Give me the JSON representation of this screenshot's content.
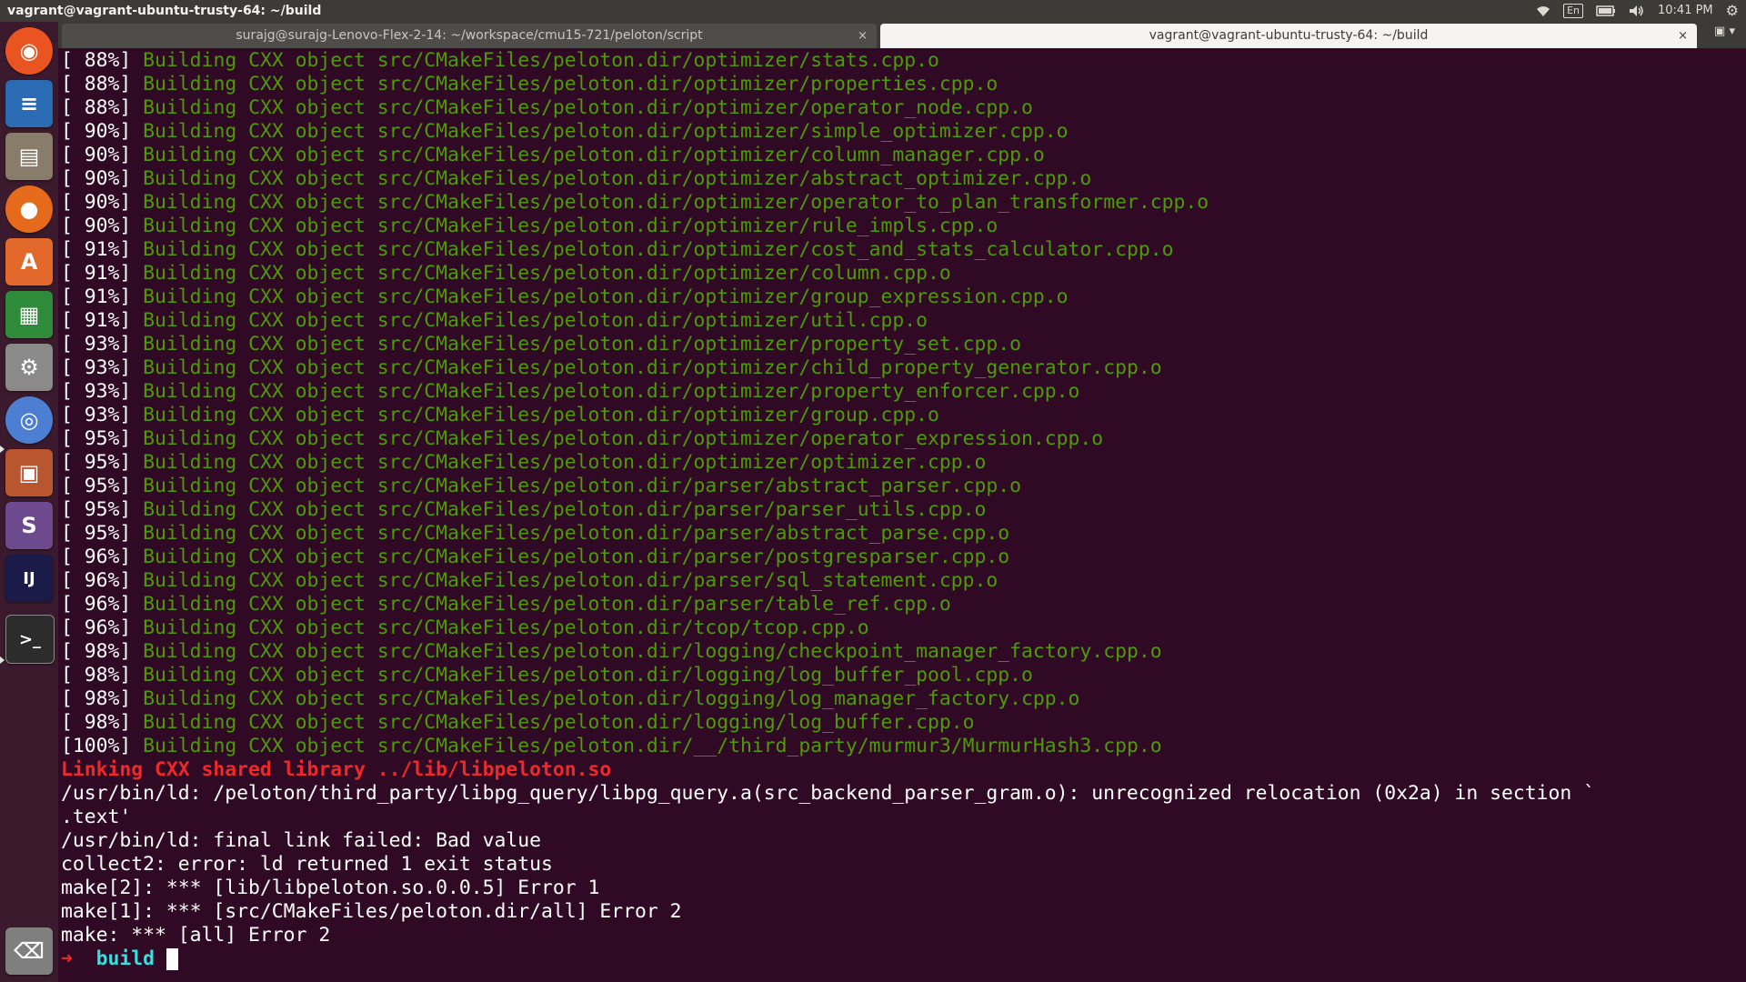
{
  "window": {
    "title": "vagrant@vagrant-ubuntu-trusty-64: ~/build"
  },
  "panel": {
    "keyboard_layout": "En",
    "clock": "10:41 PM",
    "icons": [
      "wifi-icon",
      "keyboard-icon",
      "battery-icon",
      "volume-icon",
      "gear-icon"
    ]
  },
  "launcher": {
    "items": [
      {
        "name": "ubuntu-dash-icon",
        "color": "#e95420",
        "glyph": "◉"
      },
      {
        "name": "writer-icon",
        "color": "#2a6bb3",
        "glyph": "≡"
      },
      {
        "name": "files-icon",
        "color": "#8a7c6a",
        "glyph": "▤"
      },
      {
        "name": "firefox-icon",
        "color": "#e56a1c",
        "glyph": "●"
      },
      {
        "name": "software-center-icon",
        "color": "#e2692b",
        "glyph": "A"
      },
      {
        "name": "calc-icon",
        "color": "#2e8b3a",
        "glyph": "▦"
      },
      {
        "name": "settings-icon",
        "color": "#8a8a8a",
        "glyph": "⚙"
      },
      {
        "name": "chromium-icon",
        "color": "#4c7fd1",
        "glyph": "◎"
      },
      {
        "name": "impress-icon",
        "color": "#b9552f",
        "glyph": "▣"
      },
      {
        "name": "slack-icon",
        "color": "#6d4a8e",
        "glyph": "S"
      },
      {
        "name": "intellij-icon",
        "color": "#1b1b4a",
        "glyph": "IJ"
      },
      {
        "name": "terminal-icon",
        "color": "#2c2c2c",
        "glyph": ">_"
      },
      {
        "name": "trash-icon",
        "color": "#7f7f7f",
        "glyph": "⌫"
      }
    ]
  },
  "tabs": [
    {
      "label": "surajg@surajg-Lenovo-Flex-2-14: ~/workspace/cmu15-721/peloton/script",
      "close": "×"
    },
    {
      "label": "vagrant@vagrant-ubuntu-trusty-64: ~/build",
      "close": "×"
    }
  ],
  "terminal": {
    "build_lines": [
      {
        "pct": "[ 88%]",
        "text": "Building CXX object src/CMakeFiles/peloton.dir/optimizer/stats.cpp.o"
      },
      {
        "pct": "[ 88%]",
        "text": "Building CXX object src/CMakeFiles/peloton.dir/optimizer/properties.cpp.o"
      },
      {
        "pct": "[ 88%]",
        "text": "Building CXX object src/CMakeFiles/peloton.dir/optimizer/operator_node.cpp.o"
      },
      {
        "pct": "[ 90%]",
        "text": "Building CXX object src/CMakeFiles/peloton.dir/optimizer/simple_optimizer.cpp.o"
      },
      {
        "pct": "[ 90%]",
        "text": "Building CXX object src/CMakeFiles/peloton.dir/optimizer/column_manager.cpp.o"
      },
      {
        "pct": "[ 90%]",
        "text": "Building CXX object src/CMakeFiles/peloton.dir/optimizer/abstract_optimizer.cpp.o"
      },
      {
        "pct": "[ 90%]",
        "text": "Building CXX object src/CMakeFiles/peloton.dir/optimizer/operator_to_plan_transformer.cpp.o"
      },
      {
        "pct": "[ 90%]",
        "text": "Building CXX object src/CMakeFiles/peloton.dir/optimizer/rule_impls.cpp.o"
      },
      {
        "pct": "[ 91%]",
        "text": "Building CXX object src/CMakeFiles/peloton.dir/optimizer/cost_and_stats_calculator.cpp.o"
      },
      {
        "pct": "[ 91%]",
        "text": "Building CXX object src/CMakeFiles/peloton.dir/optimizer/column.cpp.o"
      },
      {
        "pct": "[ 91%]",
        "text": "Building CXX object src/CMakeFiles/peloton.dir/optimizer/group_expression.cpp.o"
      },
      {
        "pct": "[ 91%]",
        "text": "Building CXX object src/CMakeFiles/peloton.dir/optimizer/util.cpp.o"
      },
      {
        "pct": "[ 93%]",
        "text": "Building CXX object src/CMakeFiles/peloton.dir/optimizer/property_set.cpp.o"
      },
      {
        "pct": "[ 93%]",
        "text": "Building CXX object src/CMakeFiles/peloton.dir/optimizer/child_property_generator.cpp.o"
      },
      {
        "pct": "[ 93%]",
        "text": "Building CXX object src/CMakeFiles/peloton.dir/optimizer/property_enforcer.cpp.o"
      },
      {
        "pct": "[ 93%]",
        "text": "Building CXX object src/CMakeFiles/peloton.dir/optimizer/group.cpp.o"
      },
      {
        "pct": "[ 95%]",
        "text": "Building CXX object src/CMakeFiles/peloton.dir/optimizer/operator_expression.cpp.o"
      },
      {
        "pct": "[ 95%]",
        "text": "Building CXX object src/CMakeFiles/peloton.dir/optimizer/optimizer.cpp.o"
      },
      {
        "pct": "[ 95%]",
        "text": "Building CXX object src/CMakeFiles/peloton.dir/parser/abstract_parser.cpp.o"
      },
      {
        "pct": "[ 95%]",
        "text": "Building CXX object src/CMakeFiles/peloton.dir/parser/parser_utils.cpp.o"
      },
      {
        "pct": "[ 95%]",
        "text": "Building CXX object src/CMakeFiles/peloton.dir/parser/abstract_parse.cpp.o"
      },
      {
        "pct": "[ 96%]",
        "text": "Building CXX object src/CMakeFiles/peloton.dir/parser/postgresparser.cpp.o"
      },
      {
        "pct": "[ 96%]",
        "text": "Building CXX object src/CMakeFiles/peloton.dir/parser/sql_statement.cpp.o"
      },
      {
        "pct": "[ 96%]",
        "text": "Building CXX object src/CMakeFiles/peloton.dir/parser/table_ref.cpp.o"
      },
      {
        "pct": "[ 96%]",
        "text": "Building CXX object src/CMakeFiles/peloton.dir/tcop/tcop.cpp.o"
      },
      {
        "pct": "[ 98%]",
        "text": "Building CXX object src/CMakeFiles/peloton.dir/logging/checkpoint_manager_factory.cpp.o"
      },
      {
        "pct": "[ 98%]",
        "text": "Building CXX object src/CMakeFiles/peloton.dir/logging/log_buffer_pool.cpp.o"
      },
      {
        "pct": "[ 98%]",
        "text": "Building CXX object src/CMakeFiles/peloton.dir/logging/log_manager_factory.cpp.o"
      },
      {
        "pct": "[ 98%]",
        "text": "Building CXX object src/CMakeFiles/peloton.dir/logging/log_buffer.cpp.o"
      },
      {
        "pct": "[100%]",
        "text": "Building CXX object src/CMakeFiles/peloton.dir/__/third_party/murmur3/MurmurHash3.cpp.o"
      }
    ],
    "link_line": "Linking CXX shared library ../lib/libpeloton.so",
    "output_lines": [
      "/usr/bin/ld: /peloton/third_party/libpg_query/libpg_query.a(src_backend_parser_gram.o): unrecognized relocation (0x2a) in section `",
      ".text'",
      "/usr/bin/ld: final link failed: Bad value",
      "collect2: error: ld returned 1 exit status",
      "make[2]: *** [lib/libpeloton.so.0.0.5] Error 1",
      "make[1]: *** [src/CMakeFiles/peloton.dir/all] Error 2",
      "make: *** [all] Error 2"
    ],
    "prompt": {
      "arrow": "➜",
      "dir": "build"
    }
  },
  "colors": {
    "terminal_bg": "#300a24",
    "build_green": "#4e9a06",
    "link_red": "#ef2929",
    "prompt_cyan": "#34e2e2"
  }
}
